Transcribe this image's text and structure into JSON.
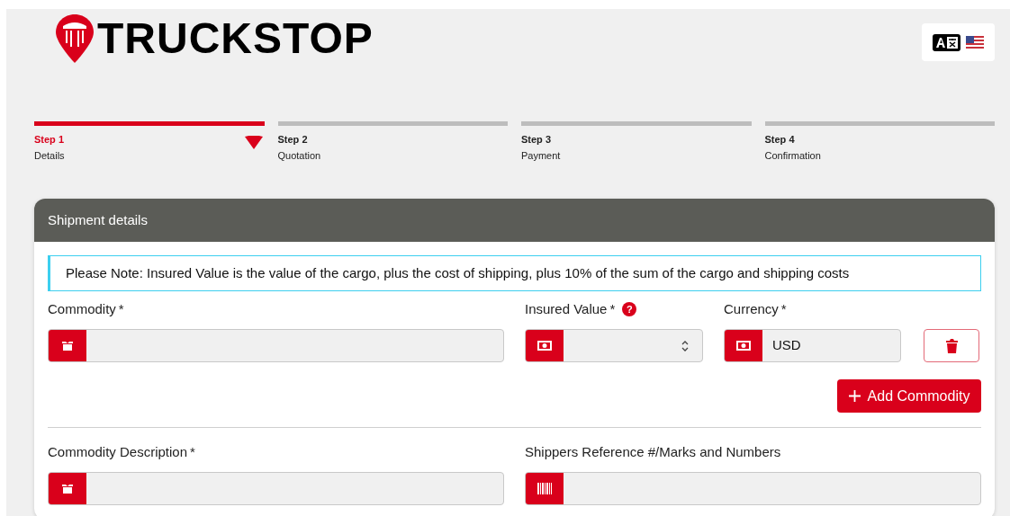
{
  "brand": {
    "name": "TRUCKSTOP"
  },
  "steps": [
    {
      "title": "Step 1",
      "label": "Details",
      "selected": true
    },
    {
      "title": "Step 2",
      "label": "Quotation",
      "selected": false
    },
    {
      "title": "Step 3",
      "label": "Payment",
      "selected": false
    },
    {
      "title": "Step 4",
      "label": "Confirmation",
      "selected": false
    }
  ],
  "panel": {
    "title": "Shipment details",
    "note": "Please Note: Insured Value is the value of the cargo, plus the cost of shipping, plus 10% of the sum of the cargo and shipping costs",
    "row1": [
      {
        "kind": "box",
        "label": "Commodity",
        "required_mark": "*"
      },
      {
        "kind": "number",
        "label": "Insured Value",
        "required_mark": "*",
        "help_mark": "?"
      },
      {
        "kind": "money",
        "label": "Currency",
        "required_mark": "*",
        "value": "USD"
      }
    ],
    "add_button": "Add Commodity",
    "row2": [
      {
        "kind": "box",
        "label": "Commodity Description",
        "required_mark": "*"
      },
      {
        "kind": "barcode",
        "label": "Shippers Reference #/Marks and Numbers"
      }
    ]
  }
}
